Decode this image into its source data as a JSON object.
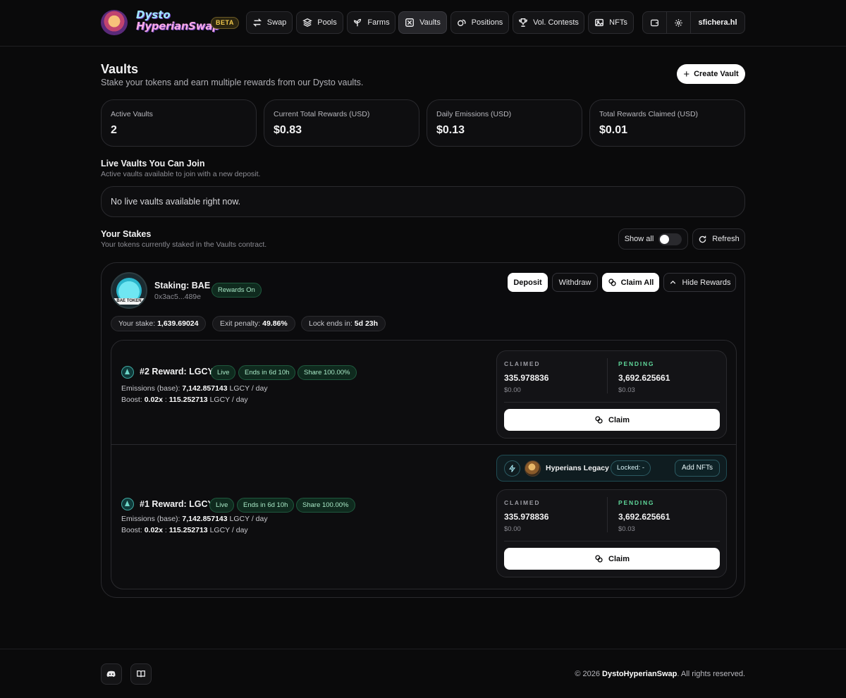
{
  "brand": {
    "line1": "Dysto",
    "line2": "HyperianSwap",
    "beta": "BETA"
  },
  "nav": [
    {
      "label": "Swap",
      "icon": "swap-icon"
    },
    {
      "label": "Pools",
      "icon": "layers-icon"
    },
    {
      "label": "Farms",
      "icon": "sprout-icon"
    },
    {
      "label": "Vaults",
      "icon": "vault-icon",
      "active": true
    },
    {
      "label": "Positions",
      "icon": "coins-icon"
    },
    {
      "label": "Vol. Contests",
      "icon": "trophy-icon"
    },
    {
      "label": "NFTs",
      "icon": "image-icon"
    }
  ],
  "account": {
    "name": "sfichera.hl"
  },
  "page": {
    "title": "Vaults",
    "subtitle": "Stake your tokens and earn multiple rewards from our Dysto vaults.",
    "create_label": "Create Vault"
  },
  "stats": [
    {
      "label": "Active Vaults",
      "value": "2"
    },
    {
      "label": "Current Total Rewards (USD)",
      "value": "$0.83"
    },
    {
      "label": "Daily Emissions (USD)",
      "value": "$0.13"
    },
    {
      "label": "Total Rewards Claimed (USD)",
      "value": "$0.01"
    }
  ],
  "live": {
    "title": "Live Vaults You Can Join",
    "subtitle": "Active vaults available to join with a new deposit.",
    "empty": "No live vaults available right now."
  },
  "stakes": {
    "title": "Your Stakes",
    "subtitle": "Your tokens currently staked in the Vaults contract.",
    "show_all": "Show all",
    "refresh": "Refresh"
  },
  "card": {
    "token_tag": "BAE TOKEN",
    "name": "Staking: BAE",
    "address": "0x3ac5...489e",
    "rewards_badge": "Rewards On",
    "deposit": "Deposit",
    "withdraw": "Withdraw",
    "claim_all": "Claim All",
    "hide_rewards": "Hide Rewards",
    "stake_label": "Your stake:",
    "stake_value": "1,639.69024",
    "penalty_label": "Exit penalty:",
    "penalty_value": "49.86%",
    "lock_label": "Lock ends in:",
    "lock_value": "5d 23h"
  },
  "rewards": [
    {
      "title": "#2 Reward: LGCY",
      "status": "Live",
      "ends": "Ends in 6d 10h",
      "share": "Share 100.00%",
      "emissions_label": "Emissions (base):",
      "emissions_value": "7,142.857143",
      "emissions_unit": "LGCY / day",
      "boost_label": "Boost:",
      "boost_mult": "0.02x",
      "boost_sep": ":",
      "boost_value": "115.252713",
      "boost_unit": "LGCY / day",
      "claimed_label": "CLAIMED",
      "claimed_value": "335.978836",
      "claimed_usd": "$0.00",
      "pending_label": "PENDING",
      "pending_value": "3,692.625661",
      "pending_usd": "$0.03",
      "claim_label": "Claim"
    },
    {
      "title": "#1 Reward: LGCY",
      "status": "Live",
      "ends": "Ends in 6d 10h",
      "share": "Share 100.00%",
      "emissions_label": "Emissions (base):",
      "emissions_value": "7,142.857143",
      "emissions_unit": "LGCY / day",
      "boost_label": "Boost:",
      "boost_mult": "0.02x",
      "boost_sep": ":",
      "boost_value": "115.252713",
      "boost_unit": "LGCY / day",
      "claimed_label": "CLAIMED",
      "claimed_value": "335.978836",
      "claimed_usd": "$0.00",
      "pending_label": "PENDING",
      "pending_value": "3,692.625661",
      "pending_usd": "$0.03",
      "claim_label": "Claim",
      "nft": {
        "collection": "Hyperians Legacy",
        "locked": "Locked: -",
        "add_label": "Add NFTs"
      }
    }
  ],
  "footer": {
    "copyright_prefix": "© 2026",
    "copyright_brand": "DystoHyperianSwap",
    "copyright_suffix": ". All rights reserved."
  },
  "colors": {
    "accent_green": "#5fd69a",
    "background": "#0a0a0b",
    "panel": "#0e0e10"
  }
}
